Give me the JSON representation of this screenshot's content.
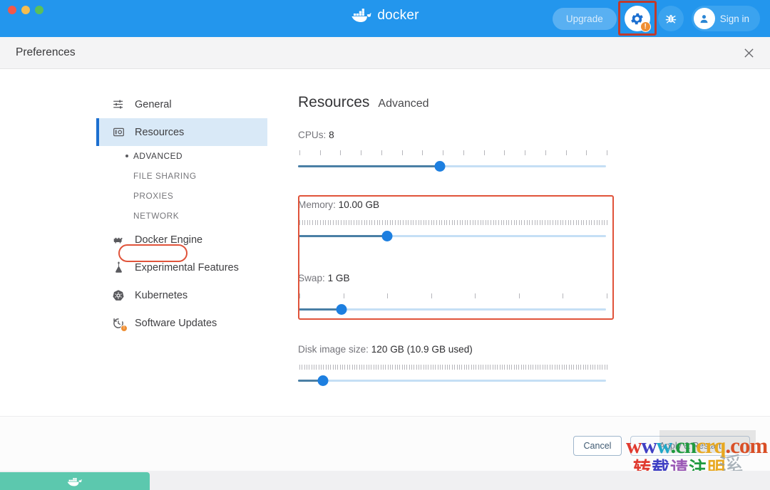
{
  "titlebar": {
    "brand": "docker",
    "brand_icon": "docker-whale-icon",
    "upgrade_label": "Upgrade",
    "gear_icon": "gear-icon",
    "gear_badge": "!",
    "bug_icon": "bug-icon",
    "signin_label": "Sign in",
    "avatar_icon": "user-avatar-icon",
    "accent_color": "#2396ed",
    "badge_color": "#ef8f34",
    "traffic_lights": [
      "close-red",
      "minimize-yellow",
      "zoom-green"
    ]
  },
  "prefs": {
    "title": "Preferences",
    "close_icon": "close-icon"
  },
  "sidebar": {
    "items": [
      {
        "label": "General",
        "icon": "sliders-icon",
        "active": false
      },
      {
        "label": "Resources",
        "icon": "resources-icon",
        "active": true
      },
      {
        "label": "Docker Engine",
        "icon": "engine-icon",
        "active": false
      },
      {
        "label": "Experimental Features",
        "icon": "flask-icon",
        "active": false
      },
      {
        "label": "Kubernetes",
        "icon": "kubernetes-helm-icon",
        "active": false
      },
      {
        "label": "Software Updates",
        "icon": "clock-update-icon",
        "active": false,
        "badge": "!"
      }
    ],
    "sub_items": [
      {
        "label": "ADVANCED",
        "selected": true,
        "highlighted": true
      },
      {
        "label": "FILE SHARING",
        "selected": false,
        "highlighted": false
      },
      {
        "label": "PROXIES",
        "selected": false,
        "highlighted": false
      },
      {
        "label": "NETWORK",
        "selected": false,
        "highlighted": false
      }
    ]
  },
  "main": {
    "page_title": "Resources",
    "page_subtitle": "Advanced",
    "highlight_color": "#e0533a",
    "sliders": [
      {
        "name": "cpus",
        "label_prefix": "CPUs: ",
        "value_text": "8",
        "fill_percent": 46,
        "tick_count": 16,
        "highlighted": true
      },
      {
        "name": "memory",
        "label_prefix": "Memory: ",
        "value_text": "10.00 GB",
        "fill_percent": 29,
        "tick_count": 120,
        "highlighted": true
      },
      {
        "name": "swap",
        "label_prefix": "Swap: ",
        "value_text": "1 GB",
        "fill_percent": 14,
        "tick_count": 8,
        "highlighted": false
      },
      {
        "name": "disk-image-size",
        "label_prefix": "Disk image size: ",
        "value_text": "120 GB (10.9 GB used)",
        "fill_percent": 8,
        "tick_count": 130,
        "highlighted": false
      }
    ]
  },
  "footer": {
    "cancel_label": "Cancel",
    "apply_label": "Apply & Restart"
  },
  "watermark": {
    "line1_parts": [
      "w",
      "w",
      "w",
      ".cn",
      "crq",
      ".com"
    ],
    "line2_parts": [
      "转",
      "载",
      "请",
      "注",
      "明"
    ],
    "brush_char": "溪"
  },
  "dock": {
    "icon": "docker-whale-icon",
    "color": "#5cc8ae"
  }
}
